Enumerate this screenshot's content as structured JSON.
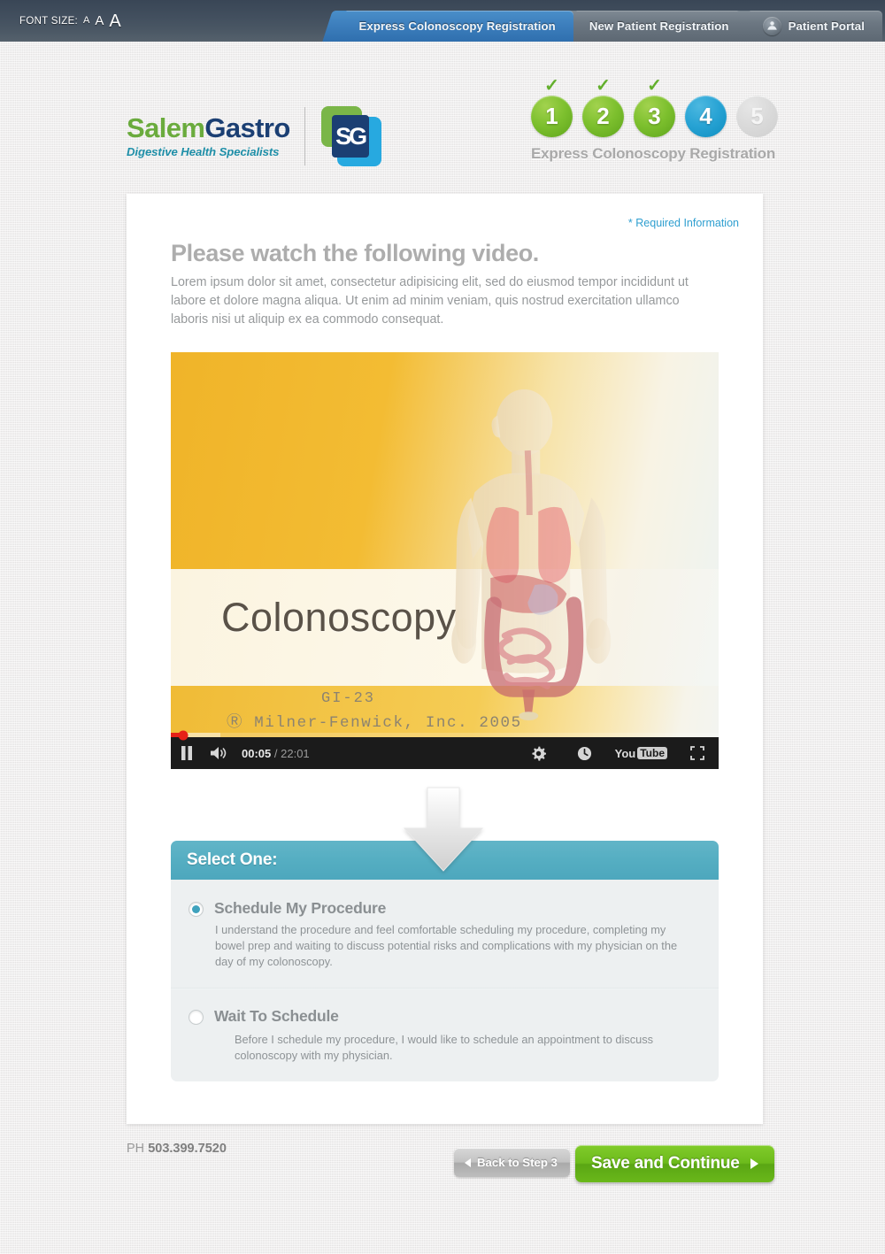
{
  "topbar": {
    "font_size_label": "FONT SIZE:",
    "font_size_options": [
      "A",
      "A",
      "A"
    ],
    "tabs": [
      {
        "label": "Express Colonoscopy Registration",
        "active": true
      },
      {
        "label": "New Patient Registration",
        "active": false
      },
      {
        "label": "Patient Portal",
        "active": false,
        "icon": "patient-icon"
      }
    ]
  },
  "logo": {
    "name_first": "Salem",
    "name_second": "Gastro",
    "tagline": "Digestive Health Specialists",
    "mark_text": "SG"
  },
  "steps": {
    "items": [
      {
        "number": "1",
        "state": "done",
        "check": "✓"
      },
      {
        "number": "2",
        "state": "done",
        "check": "✓"
      },
      {
        "number": "3",
        "state": "done",
        "check": "✓"
      },
      {
        "number": "4",
        "state": "active",
        "check": ""
      },
      {
        "number": "5",
        "state": "todo",
        "check": ""
      }
    ],
    "caption": "Express Colonoscopy Registration"
  },
  "card": {
    "required_note": "* Required Information",
    "heading": "Please watch the following video.",
    "intro": "Lorem ipsum dolor sit amet, consectetur adipisicing elit, sed do eiusmod tempor incididunt ut labore et dolore magna aliqua. Ut enim ad minim veniam, quis nostrud exercitation ullamco laboris nisi ut aliquip ex ea commodo consequat."
  },
  "video": {
    "title_overlay": "Colonoscopy",
    "code_overlay": "GI-23",
    "copyright_overlay": "Ⓡ Milner-Fenwick, Inc. 2005",
    "current_time": "00:05",
    "separator": "/",
    "total_time": "22:01",
    "youtube_label": "You",
    "youtube_label2": "Tube",
    "controls": [
      "pause-button",
      "volume-button",
      "settings-gear-icon",
      "watch-later-icon",
      "youtube-logo",
      "fullscreen-button"
    ]
  },
  "select": {
    "header": "Select One:",
    "options": [
      {
        "title": "Schedule My Procedure",
        "description": "I understand the procedure and feel comfortable scheduling my procedure, completing my bowel prep and waiting to discuss potential risks and complications with my physician on the day of my colonoscopy.",
        "selected": true
      },
      {
        "title": "Wait To Schedule",
        "description": "Before I schedule my procedure, I would like to schedule an appointment to discuss colonoscopy with my physician.",
        "selected": false
      }
    ]
  },
  "footer": {
    "phone_prefix": "PH",
    "phone_number": "503.399.7520",
    "back_button": "Back to Step 3",
    "continue_button": "Save and Continue"
  },
  "colors": {
    "topbar": "#43505f",
    "active_tab": "#3d7fbd",
    "step_done": "#7dc02e",
    "step_active": "#28a3d4",
    "step_todo": "#dadada",
    "select_header": "#55aec2",
    "radio_accent": "#3fa2bd",
    "continue_button": "#6cbb1c",
    "link": "#2f9fd0",
    "logo_green": "#6aab3d",
    "logo_navy": "#1b3f73",
    "logo_teal": "#1f8fa8"
  }
}
